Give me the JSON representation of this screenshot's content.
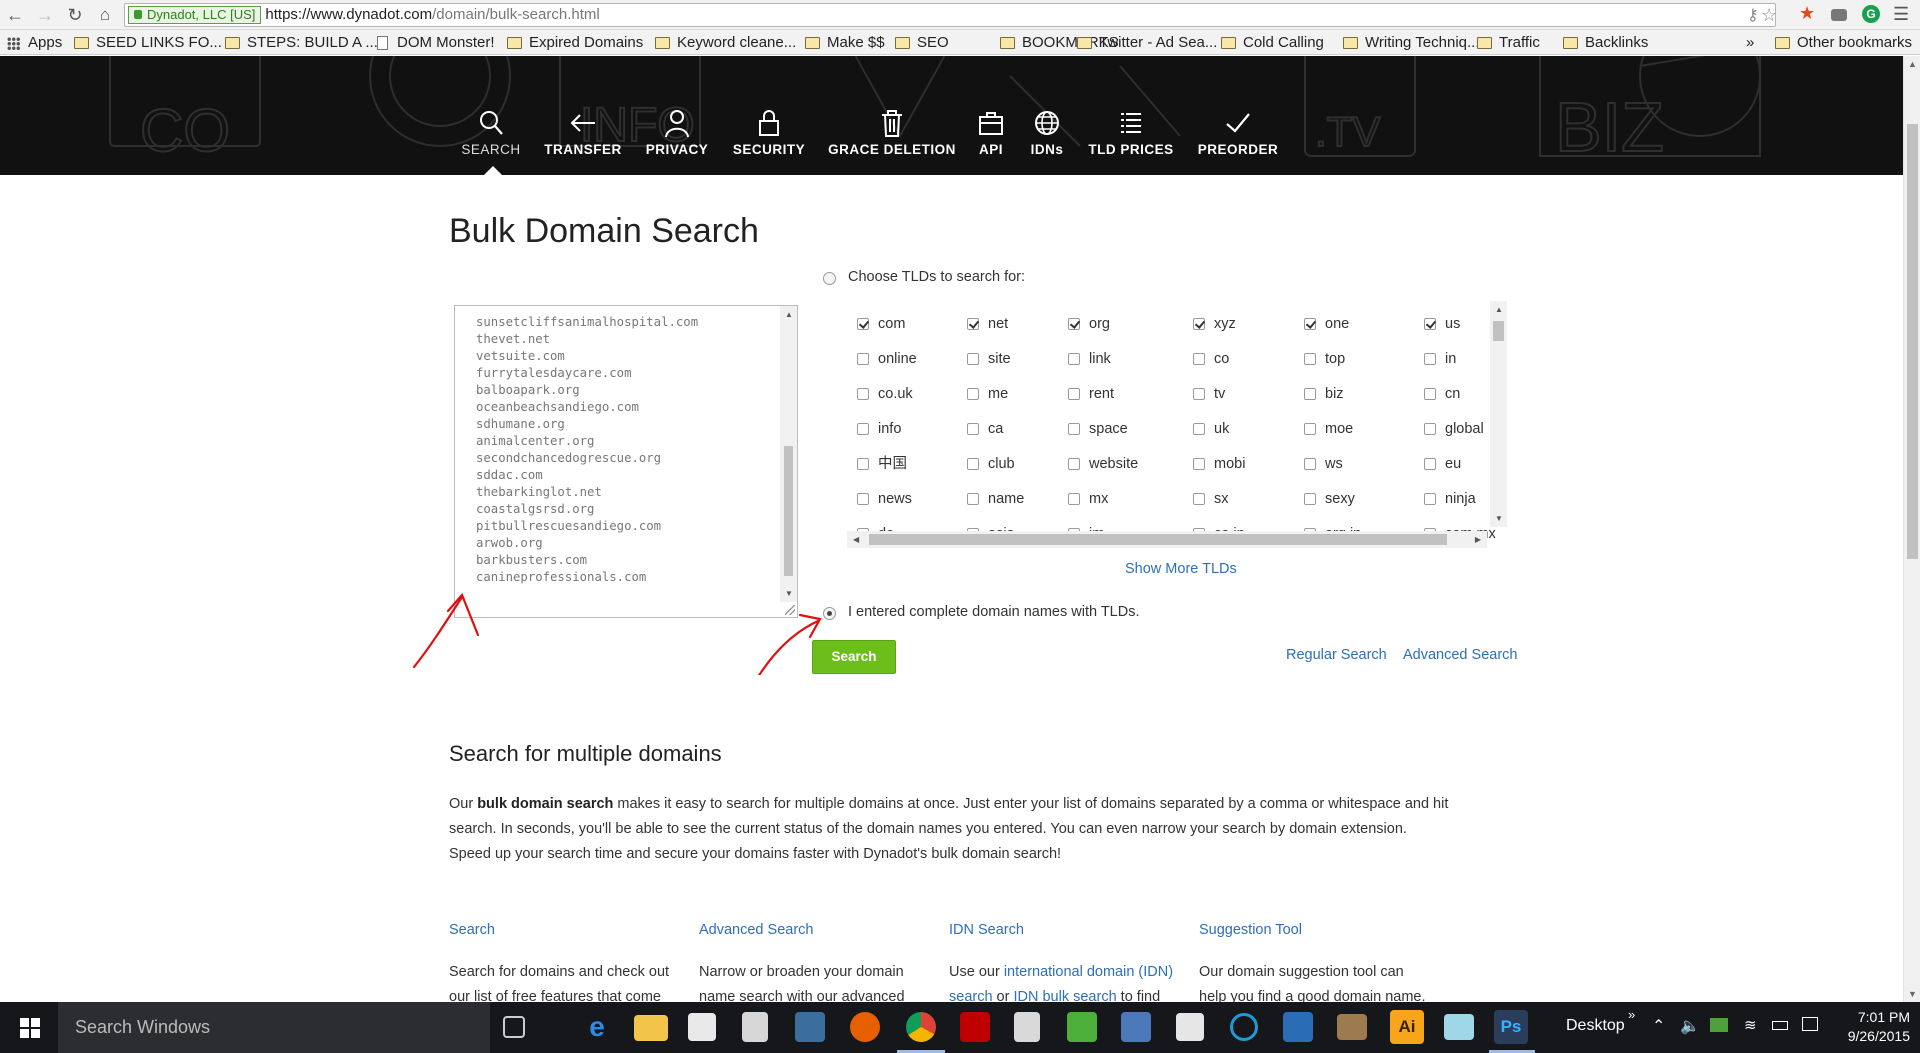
{
  "browser": {
    "ev_cert": "Dynadot, LLC [US]",
    "url_host": "https://www.dynadot.com",
    "url_path": "/domain/bulk-search.html",
    "bookmarks": [
      {
        "label": "Apps",
        "icon": "apps-grid-icon"
      },
      {
        "label": "SEED LINKS FO...",
        "icon": "folder-icon"
      },
      {
        "label": "STEPS: BUILD A ...",
        "icon": "folder-icon"
      },
      {
        "label": "DOM Monster!",
        "icon": "page-icon"
      },
      {
        "label": "Expired Domains",
        "icon": "folder-icon"
      },
      {
        "label": "Keyword cleane...",
        "icon": "folder-icon"
      },
      {
        "label": "Make $$",
        "icon": "folder-icon"
      },
      {
        "label": "SEO",
        "icon": "folder-icon"
      },
      {
        "label": "BOOKMARKS",
        "icon": "folder-icon"
      },
      {
        "label": "Twitter - Ad Sea...",
        "icon": "folder-icon"
      },
      {
        "label": "Cold Calling",
        "icon": "folder-icon"
      },
      {
        "label": "Writing Techniq...",
        "icon": "folder-icon"
      },
      {
        "label": "Traffic",
        "icon": "folder-icon"
      },
      {
        "label": "Backlinks",
        "icon": "folder-icon"
      }
    ],
    "overflow": "»",
    "other_bookmarks": "Other bookmarks"
  },
  "nav": {
    "items": [
      {
        "label": "SEARCH",
        "icon": "search-icon"
      },
      {
        "label": "TRANSFER",
        "icon": "arrow-left-icon"
      },
      {
        "label": "PRIVACY",
        "icon": "user-icon"
      },
      {
        "label": "SECURITY",
        "icon": "lock-icon"
      },
      {
        "label": "GRACE DELETION",
        "icon": "trash-icon"
      },
      {
        "label": "API",
        "icon": "briefcase-icon"
      },
      {
        "label": "IDNs",
        "icon": "globe-icon"
      },
      {
        "label": "TLD PRICES",
        "icon": "list-icon"
      },
      {
        "label": "PREORDER",
        "icon": "check-icon"
      }
    ]
  },
  "main": {
    "title": "Bulk Domain Search",
    "domains": [
      "sunsetcliffsanimalhospital.com",
      "thevet.net",
      "vetsuite.com",
      "furrytalesdaycare.com",
      "balboapark.org",
      "oceanbeachsandiego.com",
      "sdhumane.org",
      "animalcenter.org",
      "secondchancedogrescue.org",
      "sddac.com",
      "thebarkinglot.net",
      "coastalgsrsd.org",
      "pitbullrescuesandiego.com",
      "arwob.org",
      "barkbusters.com",
      "canineprofessionals.com"
    ],
    "choose_tlds_label": "Choose TLDs to search for:",
    "tlds": [
      {
        "name": "com",
        "checked": true
      },
      {
        "name": "net",
        "checked": true
      },
      {
        "name": "org",
        "checked": true
      },
      {
        "name": "xyz",
        "checked": true
      },
      {
        "name": "one",
        "checked": true
      },
      {
        "name": "us",
        "checked": true
      },
      {
        "name": "online",
        "checked": false
      },
      {
        "name": "site",
        "checked": false
      },
      {
        "name": "link",
        "checked": false
      },
      {
        "name": "co",
        "checked": false
      },
      {
        "name": "top",
        "checked": false
      },
      {
        "name": "in",
        "checked": false
      },
      {
        "name": "co.uk",
        "checked": false
      },
      {
        "name": "me",
        "checked": false
      },
      {
        "name": "rent",
        "checked": false
      },
      {
        "name": "tv",
        "checked": false
      },
      {
        "name": "biz",
        "checked": false
      },
      {
        "name": "cn",
        "checked": false
      },
      {
        "name": "info",
        "checked": false
      },
      {
        "name": "ca",
        "checked": false
      },
      {
        "name": "space",
        "checked": false
      },
      {
        "name": "uk",
        "checked": false
      },
      {
        "name": "moe",
        "checked": false
      },
      {
        "name": "global",
        "checked": false
      },
      {
        "name": "中国",
        "checked": false
      },
      {
        "name": "club",
        "checked": false
      },
      {
        "name": "website",
        "checked": false
      },
      {
        "name": "mobi",
        "checked": false
      },
      {
        "name": "ws",
        "checked": false
      },
      {
        "name": "eu",
        "checked": false
      },
      {
        "name": "news",
        "checked": false
      },
      {
        "name": "name",
        "checked": false
      },
      {
        "name": "mx",
        "checked": false
      },
      {
        "name": "sx",
        "checked": false
      },
      {
        "name": "sexy",
        "checked": false
      },
      {
        "name": "ninja",
        "checked": false
      },
      {
        "name": "de",
        "checked": false
      },
      {
        "name": "asia",
        "checked": false
      },
      {
        "name": "im",
        "checked": false
      },
      {
        "name": "co.in",
        "checked": false
      },
      {
        "name": "org.in",
        "checked": false
      },
      {
        "name": "com.mx",
        "checked": false
      }
    ],
    "show_more": "Show More TLDs",
    "complete_names_label": "I entered complete domain names with TLDs.",
    "search_button": "Search",
    "regular_search": "Regular Search",
    "advanced_search": "Advanced Search"
  },
  "info": {
    "title": "Search for multiple domains",
    "desc_pre": "Our ",
    "desc_bold": "bulk domain search",
    "desc_post": " makes it easy to search for multiple domains at once. Just enter your list of domains separated by a comma or whitespace and hit search. In seconds, you'll be able to see the current status of the domain names you entered. You can even narrow your search by domain extension. Speed up your search time and secure your domains faster with Dynadot's bulk domain search!",
    "columns": [
      {
        "title": "Search",
        "text": "Search for domains and check out our list of free features that come"
      },
      {
        "title": "Advanced Search",
        "text": "Narrow or broaden your domain name search with our advanced"
      },
      {
        "title": "IDN Search",
        "text_pre": "Use our ",
        "link1": "international domain (IDN) search",
        "text_mid": " or ",
        "link2": "IDN bulk search",
        "text_post": " to find"
      },
      {
        "title": "Suggestion Tool",
        "text": "Our domain suggestion tool can help you find a good domain name."
      }
    ]
  },
  "taskbar": {
    "search_placeholder": "Search Windows",
    "desktop_label": "Desktop",
    "overflow": "»",
    "time": "7:01 PM",
    "date": "9/26/2015"
  },
  "colors": {
    "accent_green": "#6cbf1b",
    "link_blue": "#2e6fb8",
    "header_bg": "#111111",
    "annotation_red": "#e01010"
  }
}
